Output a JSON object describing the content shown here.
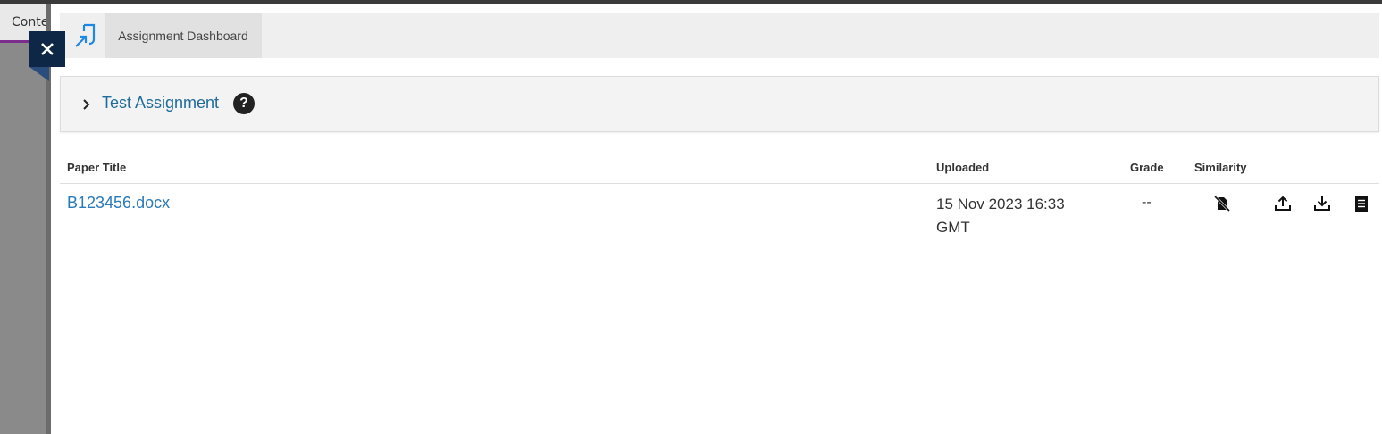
{
  "background": {
    "tab_label": "Content"
  },
  "close_label": "✕",
  "header": {
    "dashboard_tab": "Assignment Dashboard"
  },
  "assignment": {
    "title": "Test Assignment",
    "help": "?"
  },
  "table": {
    "columns": {
      "paper_title": "Paper Title",
      "uploaded": "Uploaded",
      "grade": "Grade",
      "similarity": "Similarity"
    },
    "rows": [
      {
        "paper_title": "B123456.docx",
        "uploaded_line1": "15 Nov 2023 16:33",
        "uploaded_line2": "GMT",
        "grade": "--",
        "similarity_icon": "no-report-icon",
        "actions": [
          "upload-icon",
          "download-icon",
          "receipt-icon"
        ]
      }
    ]
  },
  "colors": {
    "link": "#2a7ab8",
    "close_bg": "#0f2747",
    "brand_icon": "#1e88e5"
  }
}
